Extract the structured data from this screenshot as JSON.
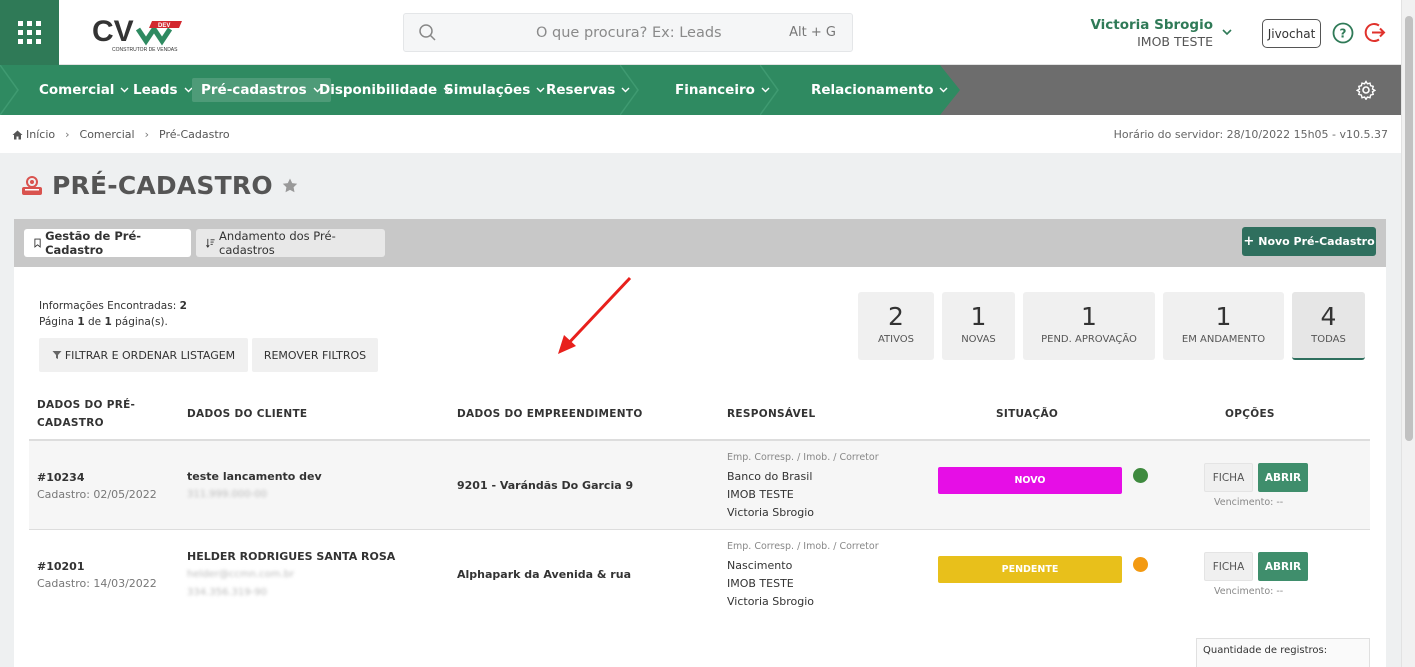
{
  "header": {
    "search_placeholder": "O que procura? Ex: Leads",
    "search_shortcut": "Alt + G",
    "user_name": "Victoria Sbrogio",
    "user_company": "IMOB TESTE",
    "jivochat_label": "Jivochat",
    "logo_text": "CV",
    "logo_badge": "DEV",
    "logo_subtitle": "CONSTRUTOR DE VENDAS"
  },
  "nav": {
    "items": [
      {
        "label": "Comercial"
      },
      {
        "label": "Leads"
      },
      {
        "label": "Pré-cadastros"
      },
      {
        "label": "Disponibilidade"
      },
      {
        "label": "Simulações"
      },
      {
        "label": "Reservas"
      },
      {
        "label": "Financeiro"
      },
      {
        "label": "Relacionamento"
      }
    ]
  },
  "breadcrumb": {
    "home": "Início",
    "level1": "Comercial",
    "level2": "Pré-Cadastro",
    "server_time": "Horário do servidor: 28/10/2022 15h05 - v10.5.37"
  },
  "page": {
    "title": "PRÉ-CADASTRO"
  },
  "tabs": {
    "gestao": "Gestão de Pré-Cadastro",
    "andamento": "Andamento dos Pré-cadastros",
    "new_button": "Novo Pré-Cadastro"
  },
  "info": {
    "found_label": "Informações Encontradas:",
    "found_value": "2",
    "page_label": "Página",
    "page_current": "1",
    "page_of": "de",
    "page_total": "1",
    "page_suffix": "página(s).",
    "filter_button": "FILTRAR E ORDENAR LISTAGEM",
    "clear_button": "REMOVER FILTROS"
  },
  "stats": [
    {
      "value": "2",
      "label": "ATIVOS"
    },
    {
      "value": "1",
      "label": "NOVAS"
    },
    {
      "value": "1",
      "label": "PEND. APROVAÇÃO"
    },
    {
      "value": "1",
      "label": "EM ANDAMENTO"
    },
    {
      "value": "4",
      "label": "TODAS"
    }
  ],
  "table": {
    "headers": {
      "dados_pre_1": "DADOS DO PRÉ-",
      "dados_pre_2": "CADASTRO",
      "dados_cliente": "DADOS DO CLIENTE",
      "dados_empreendimento": "DADOS DO EMPREENDIMENTO",
      "responsavel": "RESPONSÁVEL",
      "situacao": "SITUAÇÃO",
      "opcoes": "OPÇÕES"
    },
    "rows": [
      {
        "id": "#10234",
        "cadastro": "Cadastro: 02/05/2022",
        "cliente": "teste lancamento dev",
        "cliente_extra1": "311.999.000-00",
        "cliente_extra2": "",
        "empreendimento": "9201 - Varándãs Do Garcia 9",
        "resp_header": "Emp. Corresp. / Imob. / Corretor",
        "resp1": "Banco do Brasil",
        "resp2": "IMOB TESTE",
        "resp3": "Victoria Sbrogio",
        "status": "NOVO",
        "status_color": "#e60ee6",
        "dot_color": "#3f8a3f",
        "ficha": "FICHA",
        "abrir": "ABRIR",
        "vencimento": "Vencimento: --"
      },
      {
        "id": "#10201",
        "cadastro": "Cadastro: 14/03/2022",
        "cliente": "HELDER RODRIGUES SANTA ROSA",
        "cliente_extra1": "helder@ccmn.com.br",
        "cliente_extra2": "334.356.319-90",
        "empreendimento": "Alphapark da Avenida & rua",
        "resp_header": "Emp. Corresp. / Imob. / Corretor",
        "resp1": "Nascimento",
        "resp2": "IMOB TESTE",
        "resp3": "Victoria Sbrogio",
        "status": "PENDENTE",
        "status_color": "#e8c01b",
        "dot_color": "#f39a12",
        "ficha": "FICHA",
        "abrir": "ABRIR",
        "vencimento": "Vencimento: --"
      }
    ]
  },
  "footer": {
    "qtd_label": "Quantidade de registros:"
  },
  "colors": {
    "brand_green": "#2f8a61",
    "dark_green": "#2f6f5e",
    "nav_gray": "#6d6d6d"
  }
}
